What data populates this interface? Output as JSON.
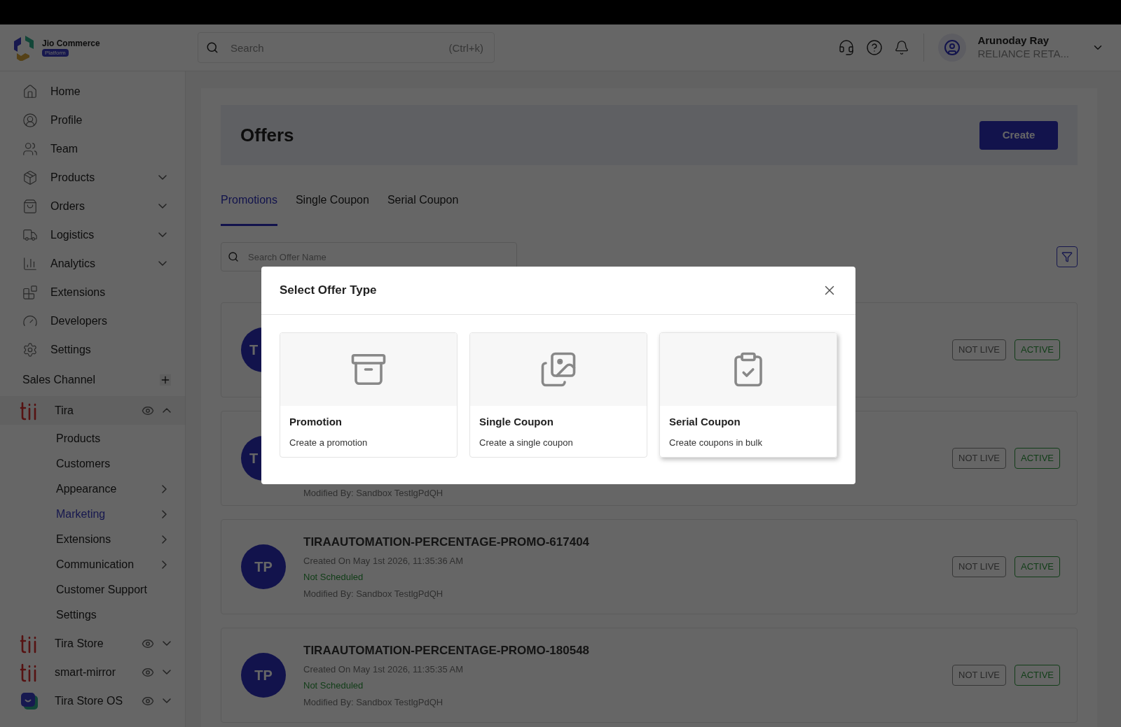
{
  "header": {
    "logo": {
      "name": "Jio Commerce",
      "badge": "Platform"
    },
    "search": {
      "placeholder": "Search",
      "shortcut": "(Ctrl+k)"
    },
    "user": {
      "name": "Arunoday Ray",
      "org": "RELIANCE RETA..."
    }
  },
  "sidebar": {
    "items": [
      {
        "label": "Home",
        "expandable": false
      },
      {
        "label": "Profile",
        "expandable": false
      },
      {
        "label": "Team",
        "expandable": false
      },
      {
        "label": "Products",
        "expandable": true
      },
      {
        "label": "Orders",
        "expandable": true
      },
      {
        "label": "Logistics",
        "expandable": true
      },
      {
        "label": "Analytics",
        "expandable": true
      },
      {
        "label": "Extensions",
        "expandable": false
      },
      {
        "label": "Developers",
        "expandable": false
      },
      {
        "label": "Settings",
        "expandable": false
      }
    ],
    "sales_channel": {
      "title": "Sales Channel"
    },
    "channels": [
      {
        "name": "Tira",
        "kind": "wordmark",
        "expanded": true,
        "children": [
          {
            "label": "Products",
            "has_arrow": false,
            "selected": false
          },
          {
            "label": "Customers",
            "has_arrow": false,
            "selected": false
          },
          {
            "label": "Appearance",
            "has_arrow": true,
            "selected": false
          },
          {
            "label": "Marketing",
            "has_arrow": true,
            "selected": true
          },
          {
            "label": "Extensions",
            "has_arrow": true,
            "selected": false
          },
          {
            "label": "Communication",
            "has_arrow": true,
            "selected": false
          },
          {
            "label": "Customer Support",
            "has_arrow": false,
            "selected": false
          },
          {
            "label": "Settings",
            "has_arrow": false,
            "selected": false
          }
        ]
      },
      {
        "name": "Tira Store",
        "kind": "wordmark",
        "expanded": false
      },
      {
        "name": "smart-mirror",
        "kind": "wordmark",
        "expanded": false
      },
      {
        "name": "Tira Store OS",
        "kind": "app",
        "expanded": false
      }
    ]
  },
  "page": {
    "title": "Offers",
    "create_button": "Create",
    "tabs": [
      {
        "label": "Promotions",
        "selected": true
      },
      {
        "label": "Single Coupon",
        "selected": false
      },
      {
        "label": "Serial Coupon",
        "selected": false
      }
    ],
    "search": {
      "placeholder": "Search Offer Name"
    },
    "offers": [
      {
        "avatar": "T",
        "badges": [
          "NOT LIVE",
          "ACTIVE"
        ]
      },
      {
        "avatar": "T",
        "modified": "Modified By: Sandbox TestlgPdQH",
        "badges": [
          "NOT LIVE",
          "ACTIVE"
        ]
      },
      {
        "avatar": "TP",
        "title": "TIRAAUTOMATION-PERCENTAGE-PROMO-617404",
        "created": "Created On May 1st 2026, 11:35:36 AM",
        "schedule": "Not Scheduled",
        "modified": "Modified By: Sandbox TestlgPdQH",
        "badges": [
          "NOT LIVE",
          "ACTIVE"
        ]
      },
      {
        "avatar": "TP",
        "title": "TIRAAUTOMATION-PERCENTAGE-PROMO-180548",
        "created": "Created On May 1st 2026, 11:35:35 AM",
        "schedule": "Not Scheduled",
        "modified": "Modified By: Sandbox TestlgPdQH",
        "badges": [
          "NOT LIVE",
          "ACTIVE"
        ]
      }
    ]
  },
  "modal": {
    "title": "Select Offer Type",
    "options": [
      {
        "title": "Promotion",
        "description": "Create a promotion",
        "hovered": false
      },
      {
        "title": "Single Coupon",
        "description": "Create a single coupon",
        "hovered": false
      },
      {
        "title": "Serial Coupon",
        "description": "Create coupons in bulk",
        "hovered": true
      }
    ]
  }
}
